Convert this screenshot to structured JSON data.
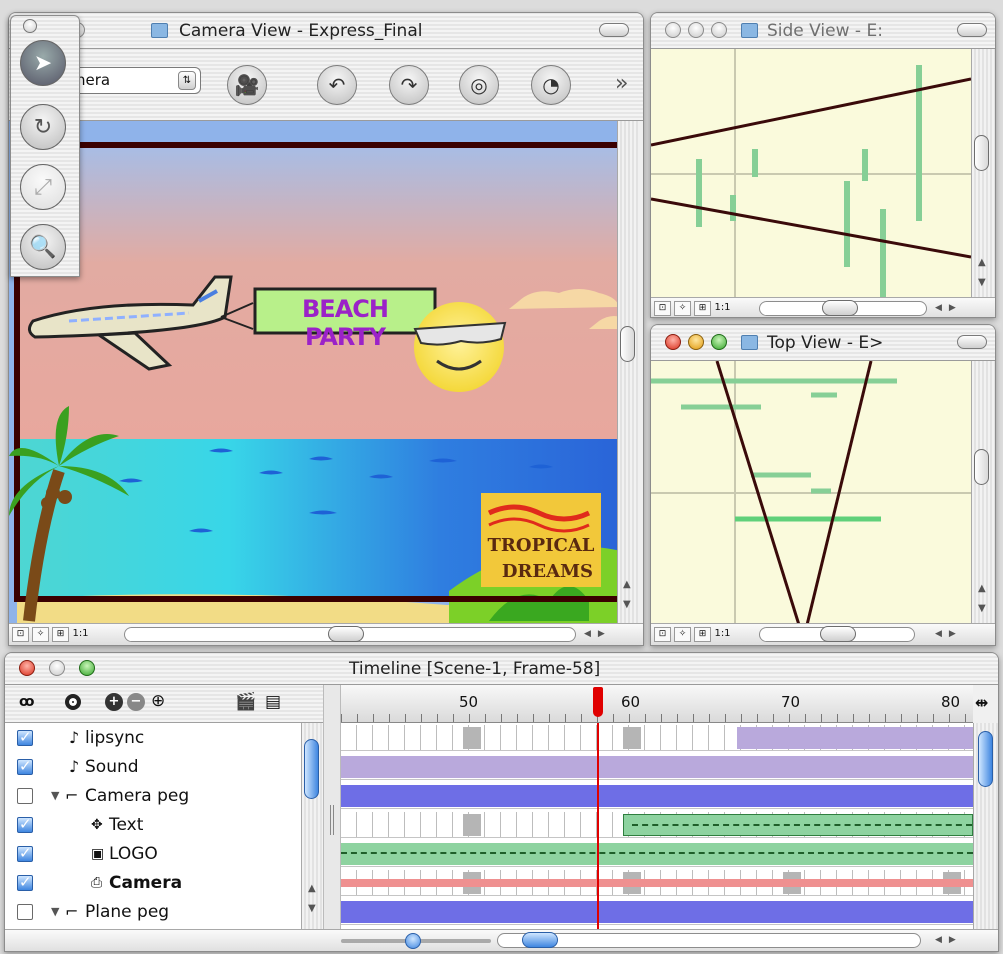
{
  "camera_window": {
    "title": "Camera View - Express_Final",
    "camera_select": "nera",
    "overflow_label": "»",
    "scene": {
      "banner_text": "BEACH PARTY",
      "logo_line1": "TROPICAL",
      "logo_line2": "DREAMS"
    }
  },
  "toolbar_icons": [
    "camera-icon",
    "rotate-path-icon",
    "tilt-path-icon",
    "pan-path-icon",
    "clock-icon"
  ],
  "tools": [
    "arrow-tool",
    "rotate-tool",
    "transform-tool",
    "zoom-tool"
  ],
  "side_view": {
    "title": "Side View - E:"
  },
  "top_view": {
    "title": "Top View - E>"
  },
  "status_icons": [
    "frame-icon",
    "magic-wand-icon",
    "grid-icon"
  ],
  "one_to_one_label": "1:1",
  "timeline": {
    "title": "Timeline [Scene-1, Frame-58]",
    "current_frame": 58,
    "ruler_labels": [
      "50",
      "60",
      "70",
      "80"
    ],
    "layers": [
      {
        "name": "lipsync",
        "checked": true,
        "icon": "note-icon"
      },
      {
        "name": "Sound",
        "checked": true,
        "icon": "note-icon"
      },
      {
        "name": "Camera peg",
        "checked": false,
        "icon": "peg-icon"
      },
      {
        "name": "Text",
        "checked": true,
        "icon": "text-element-icon"
      },
      {
        "name": "LOGO",
        "checked": true,
        "icon": "image-element-icon"
      },
      {
        "name": "Camera",
        "checked": true,
        "icon": "camera-element-icon"
      },
      {
        "name": "Plane peg",
        "checked": false,
        "icon": "peg-icon"
      }
    ]
  },
  "colors": {
    "purple_bar": "#b9a9dc",
    "blue_bar": "#6e6ee6",
    "green_bar": "#8ed3a0",
    "red_bar": "#ef9090",
    "playhead": "#e00000"
  }
}
